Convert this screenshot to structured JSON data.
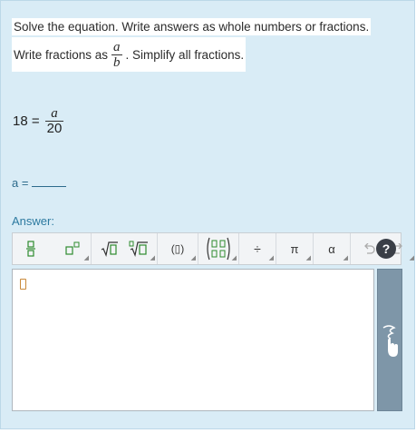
{
  "instructions": {
    "line1": "Solve the equation.  Write answers as whole numbers or fractions.",
    "line2_before": "Write fractions as",
    "frac_num": "a",
    "frac_den": "b",
    "line2_after": ". Simplify all fractions."
  },
  "equation": {
    "lhs": "18 =",
    "num": "a",
    "den": "20"
  },
  "answer_line": {
    "label": "a ="
  },
  "answer_label": "Answer:",
  "toolbar": {
    "groups": [
      {
        "icons": [
          "fraction-icon",
          "exponent-icon"
        ]
      },
      {
        "icons": [
          "square-root-icon",
          "nth-root-icon"
        ]
      },
      {
        "icons": [
          "parentheses-icon"
        ]
      },
      {
        "icons": [
          "matrix-icon"
        ]
      },
      {
        "icons": [
          "divide-icon"
        ]
      },
      {
        "icons": [
          "pi-icon"
        ]
      },
      {
        "icons": [
          "alpha-icon"
        ]
      },
      {
        "icons": [
          "undo-icon",
          "redo-icon"
        ]
      }
    ],
    "divide": "÷",
    "pi": "π",
    "alpha": "α",
    "paren": "(▯)",
    "help": "?"
  },
  "colors": {
    "panel_bg": "#d9ecf6",
    "accent_text": "#2d7aa0",
    "handle": "#7e96a8"
  }
}
